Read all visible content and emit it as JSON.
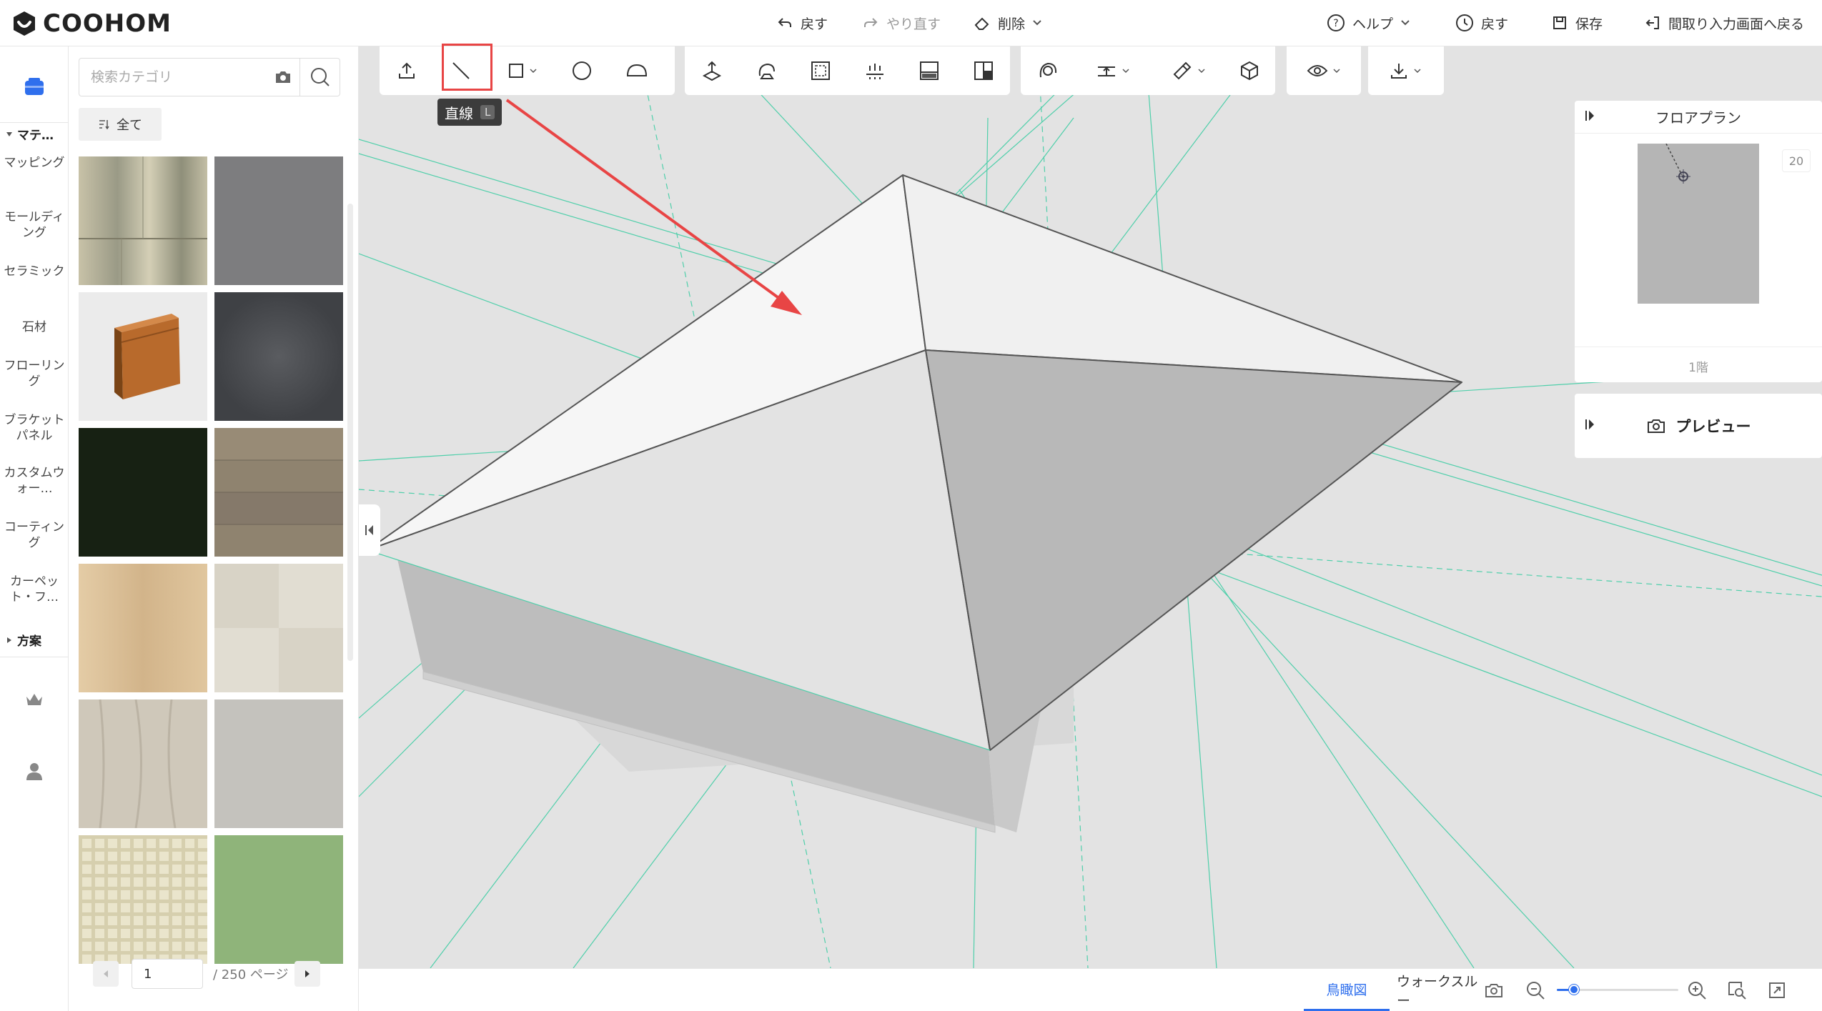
{
  "app": {
    "brand": "COOHOM"
  },
  "header": {
    "undo_label": "戻す",
    "redo_label": "やり直す",
    "delete_label": "削除",
    "help_label": "ヘルプ",
    "history_label": "戻す",
    "save_label": "保存",
    "back_label": "間取り入力画面へ戻る"
  },
  "rail": {
    "material_section": "マテ…",
    "items": [
      "マッピング",
      "モールディング",
      "セラミック",
      "石材",
      "フローリング",
      "ブラケットパネル",
      "カスタムウォー…",
      "コーティング",
      "カーペット・フ…"
    ],
    "plan_section": "方案"
  },
  "panel": {
    "search_placeholder": "検索カテゴリ",
    "filter_label": "全て",
    "materials": [
      {
        "name": "birch-plywood",
        "color": "#b9b49d"
      },
      {
        "name": "gray-fabric",
        "color": "#7b7b7d"
      },
      {
        "name": "wood-skirting",
        "color": "#e9e9e9"
      },
      {
        "name": "dark-concrete",
        "color": "#4c4e52"
      },
      {
        "name": "dark-green",
        "color": "#1a2414"
      },
      {
        "name": "gray-oak",
        "color": "#8e826f"
      },
      {
        "name": "light-oak",
        "color": "#d8bf98"
      },
      {
        "name": "cream-marble",
        "color": "#ddd8cc"
      },
      {
        "name": "white-oak",
        "color": "#ccc5b7"
      },
      {
        "name": "light-gray-grain",
        "color": "#c3c1bc"
      },
      {
        "name": "cream-plaid",
        "color": "#e6e0c6"
      },
      {
        "name": "green-plaster",
        "color": "#8fb37a"
      }
    ],
    "page_current": "1",
    "page_total_label": "/ 250 ページ"
  },
  "toolbar": {
    "active_tool": "line",
    "tooltip_label": "直線",
    "tooltip_key": "L",
    "tools": [
      "upload",
      "line",
      "rectangle",
      "circle",
      "arc",
      "push-pull",
      "rotate",
      "offset",
      "align",
      "section",
      "layers",
      "orbit",
      "dimension",
      "paint",
      "group",
      "view",
      "export"
    ]
  },
  "floorplan": {
    "title": "フロアプラン",
    "scale": "20",
    "floor_label": "1階"
  },
  "preview": {
    "label": "プレビュー"
  },
  "bottom": {
    "view_birdseye": "鳥瞰図",
    "view_walkthrough": "ウォークスルー",
    "zoom_level": 0.14
  },
  "colors": {
    "accent": "#2f6fed",
    "highlight_red": "#e84545",
    "guide_green": "#4fcfaa"
  }
}
